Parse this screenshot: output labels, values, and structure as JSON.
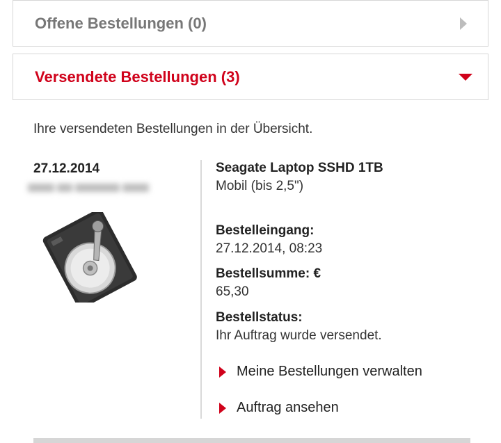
{
  "accordion": {
    "open_orders": {
      "label": "Offene Bestellungen (0)",
      "icon": "chevron-right-icon"
    },
    "shipped_orders": {
      "label": "Versendete Bestellungen (3)",
      "icon": "caret-down-icon",
      "accent": "#d0021b"
    }
  },
  "intro_text": "Ihre versendeten Bestellungen in der Übersicht.",
  "order": {
    "date": "27.12.2014",
    "product": {
      "name": "Seagate Laptop SSHD 1TB",
      "subtitle": "Mobil (bis 2,5\")"
    },
    "details": {
      "received_label": "Bestelleingang:",
      "received_value": "27.12.2014, 08:23",
      "total_label": "Bestellsumme: €",
      "total_value": "65,30",
      "status_label": "Bestellstatus:",
      "status_value": "Ihr Auftrag wurde versendet."
    },
    "links": {
      "manage": "Meine Bestellungen verwalten",
      "view": "Auftrag ansehen"
    }
  }
}
